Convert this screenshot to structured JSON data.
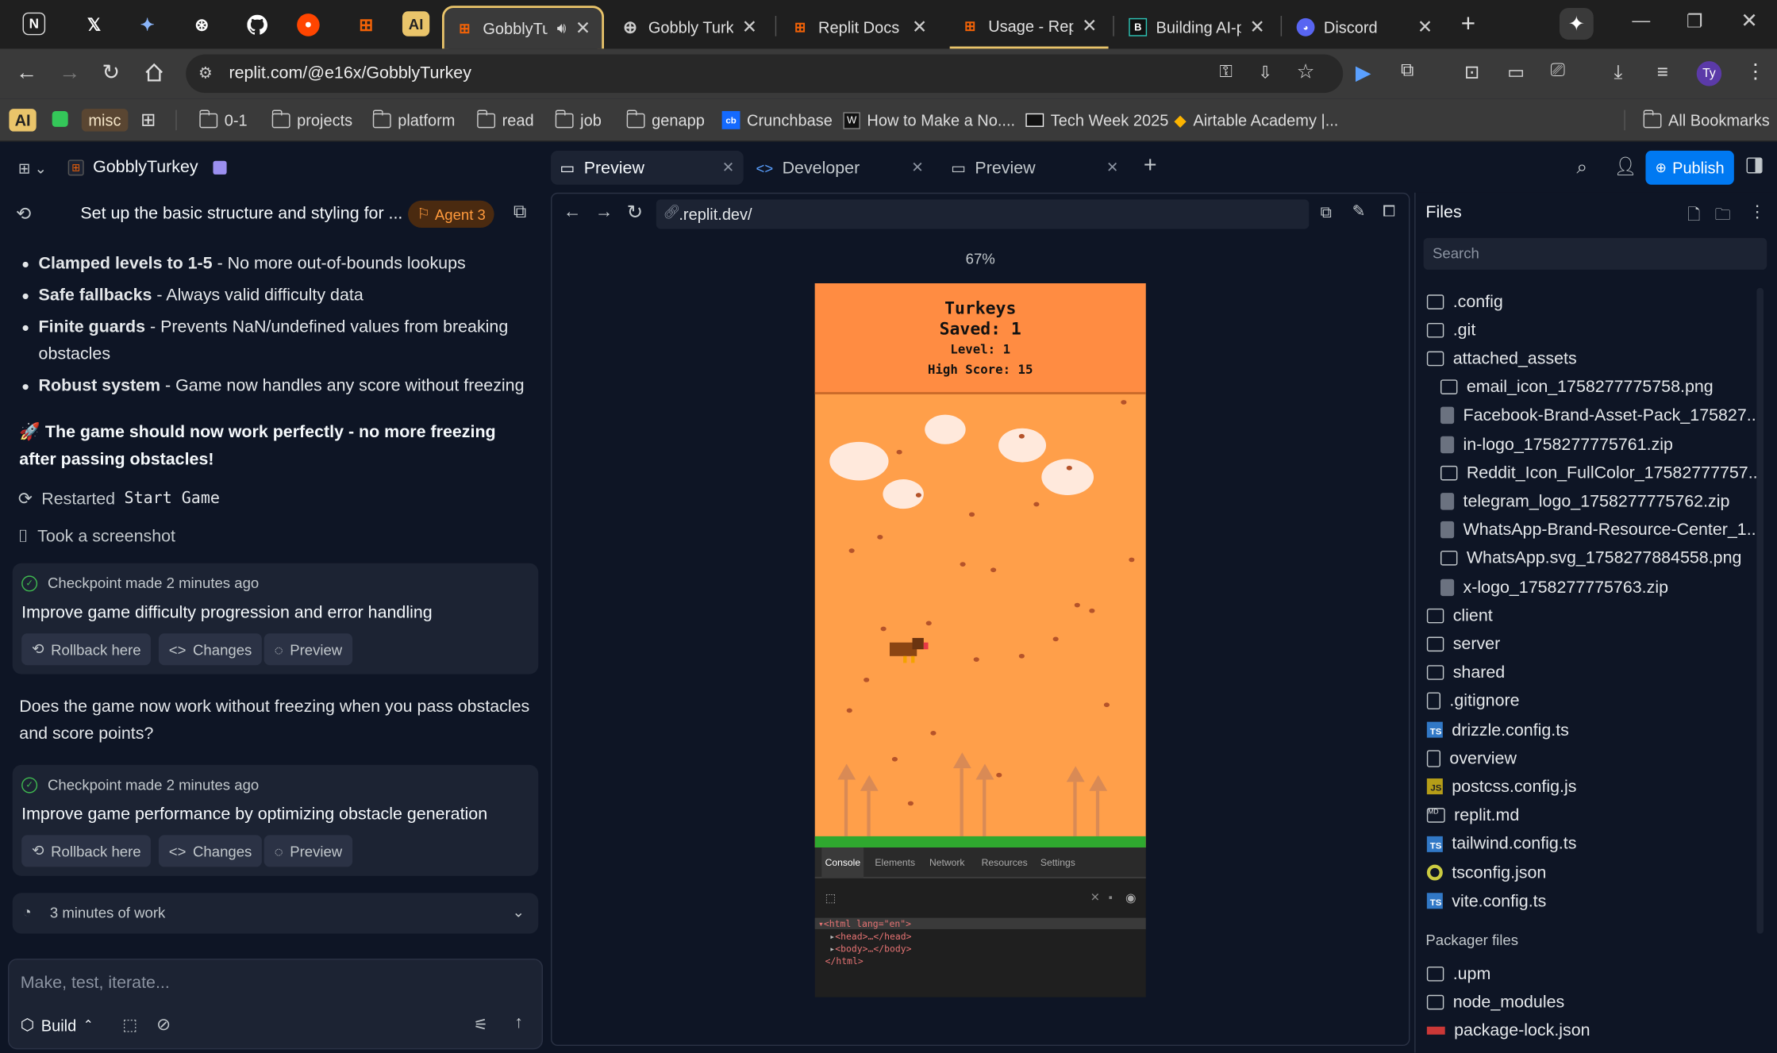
{
  "browser": {
    "pinned": [
      "N",
      "X",
      "✦",
      "⊛",
      "GH",
      "R",
      "R",
      "AI"
    ],
    "tabs": [
      {
        "title": "GobblyTu",
        "active": true
      },
      {
        "title": "Gobbly Turke"
      },
      {
        "title": "Replit Docs"
      },
      {
        "title": "Usage - Repli"
      },
      {
        "title": "Building AI-p"
      },
      {
        "title": "Discord"
      }
    ],
    "url": "replit.com/@e16x/GobblyTurkey",
    "profile": "Ty",
    "bookmarks": [
      {
        "label": "misc",
        "type": "badge"
      },
      {
        "label": "0-1",
        "type": "folder"
      },
      {
        "label": "projects",
        "type": "folder"
      },
      {
        "label": "platform",
        "type": "folder"
      },
      {
        "label": "read",
        "type": "folder"
      },
      {
        "label": "job",
        "type": "folder"
      },
      {
        "label": "genapp",
        "type": "folder"
      },
      {
        "label": "Crunchbase",
        "type": "site"
      },
      {
        "label": "How to Make a No....",
        "type": "site"
      },
      {
        "label": "Tech Week 2025",
        "type": "site"
      },
      {
        "label": "Airtable Academy |...",
        "type": "site"
      }
    ],
    "all_bookmarks": "All Bookmarks",
    "ai_badge": "AI"
  },
  "replit": {
    "project_name": "GobblyTurkey",
    "publish": "Publish",
    "chat": {
      "title": "Set up the basic structure and styling for ...",
      "agent": "Agent 3",
      "bullets": [
        {
          "bold": "Clamped levels to 1-5",
          "text": " - No more out-of-bounds lookups"
        },
        {
          "bold": "Safe fallbacks",
          "text": " - Always valid difficulty data"
        },
        {
          "bold": "Finite guards",
          "text": " - Prevents NaN/undefined values from breaking obstacles"
        },
        {
          "bold": "Robust system",
          "text": " - Game now handles any score without freezing"
        }
      ],
      "summary": "🚀 The game should now work perfectly - no more freezing after passing obstacles!",
      "restarted_prefix": "Restarted",
      "restarted_target": "Start Game",
      "screenshot": "Took a screenshot",
      "checkpoints": [
        {
          "meta": "Checkpoint made 2 minutes ago",
          "title": "Improve game difficulty progression and error handling"
        },
        {
          "meta": "Checkpoint made 2 minutes ago",
          "title": "Improve game performance by optimizing obstacle generation"
        }
      ],
      "rollback": "Rollback here",
      "changes": "Changes",
      "preview": "Preview",
      "question": "Does the game now work without freezing when you pass obstacles and score points?",
      "work": "3 minutes of work",
      "input_placeholder": "Make, test, iterate...",
      "build": "Build"
    },
    "tabs": [
      {
        "label": "Preview",
        "active": true
      },
      {
        "label": "Developer"
      },
      {
        "label": "Preview"
      }
    ],
    "preview": {
      "url": ".replit.dev/",
      "zoom": "67%",
      "game": {
        "title": "Turkeys",
        "saved": "Saved: 1",
        "level": "Level: 1",
        "high": "High Score: 15"
      },
      "devtools": {
        "tabs": [
          "Console",
          "Elements",
          "Network",
          "Resources",
          "Settings"
        ],
        "lines": [
          "<html lang=\"en\">",
          "<head>…</head>",
          "<body>…</body>",
          "</html>"
        ]
      }
    },
    "files": {
      "title": "Files",
      "search": "Search",
      "items": [
        {
          "name": ".config",
          "kind": "folder",
          "indent": 0
        },
        {
          "name": ".git",
          "kind": "folder",
          "indent": 0
        },
        {
          "name": "attached_assets",
          "kind": "folder-open",
          "indent": 0
        },
        {
          "name": "email_icon_1758277775758.png",
          "kind": "image",
          "indent": 1
        },
        {
          "name": "Facebook-Brand-Asset-Pack_175827...",
          "kind": "zip",
          "indent": 1
        },
        {
          "name": "in-logo_1758277775761.zip",
          "kind": "zip",
          "indent": 1
        },
        {
          "name": "Reddit_Icon_FullColor_17582777757...",
          "kind": "image",
          "indent": 1
        },
        {
          "name": "telegram_logo_1758277775762.zip",
          "kind": "zip",
          "indent": 1
        },
        {
          "name": "WhatsApp-Brand-Resource-Center_1...",
          "kind": "zip",
          "indent": 1
        },
        {
          "name": "WhatsApp.svg_1758277884558.png",
          "kind": "image",
          "indent": 1
        },
        {
          "name": "x-logo_1758277775763.zip",
          "kind": "zip",
          "indent": 1
        },
        {
          "name": "client",
          "kind": "folder",
          "indent": 0
        },
        {
          "name": "server",
          "kind": "folder",
          "indent": 0
        },
        {
          "name": "shared",
          "kind": "folder",
          "indent": 0
        },
        {
          "name": ".gitignore",
          "kind": "doc",
          "indent": 0
        },
        {
          "name": "drizzle.config.ts",
          "kind": "ts",
          "indent": 0
        },
        {
          "name": "overview",
          "kind": "doc",
          "indent": 0
        },
        {
          "name": "postcss.config.js",
          "kind": "js",
          "indent": 0
        },
        {
          "name": "replit.md",
          "kind": "md",
          "indent": 0
        },
        {
          "name": "tailwind.config.ts",
          "kind": "ts",
          "indent": 0
        },
        {
          "name": "tsconfig.json",
          "kind": "json",
          "indent": 0
        },
        {
          "name": "vite.config.ts",
          "kind": "ts",
          "indent": 0
        }
      ],
      "packager_title": "Packager files",
      "packager": [
        {
          "name": ".upm",
          "kind": "folder"
        },
        {
          "name": "node_modules",
          "kind": "folder"
        },
        {
          "name": "package-lock.json",
          "kind": "npm"
        }
      ]
    }
  },
  "colors": {
    "accent": "#0079f2",
    "agent_badge": "#ff8a00",
    "game_bg": "#ff9f4a"
  }
}
